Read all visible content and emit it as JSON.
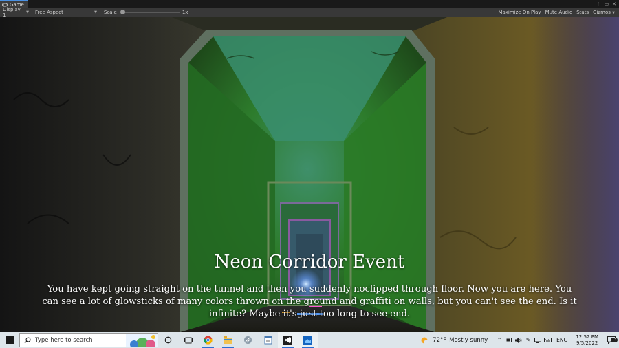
{
  "window": {
    "tab_label": "Game",
    "tab_icon": "gamepad-icon"
  },
  "toolbar": {
    "display": "Display 1",
    "aspect": "Free Aspect",
    "scale_label": "Scale",
    "scale_value": "1x",
    "maximize_on_play": "Maximize On Play",
    "mute_audio": "Mute Audio",
    "stats": "Stats",
    "gizmos": "Gizmos"
  },
  "game": {
    "title": "Neon Corridor Event",
    "body": "You have kept going straight on the tunnel and then you suddenly noclipped through floor. Now you are here. You can see a lot of glowsticks of many colors thrown on the ground and graffiti on walls, but you can't see the end. Is it infinite? Maybe it's just too long to see end."
  },
  "taskbar": {
    "search_placeholder": "Type here to search",
    "pinned": [
      "task-view-icon",
      "chrome-icon",
      "file-explorer-icon",
      "app-icon",
      "notepad-icon",
      "visual-studio-icon",
      "unity-icon"
    ],
    "weather_temp": "72°F",
    "weather_desc": "Mostly sunny",
    "language": "ENG",
    "time": "12:52 PM",
    "date": "9/5/2022",
    "notification_count": "13"
  },
  "colors": {
    "accent": "#2a6fd4",
    "tunnel_green": "#2fa030",
    "wall_yellow": "#7a6a2a"
  }
}
